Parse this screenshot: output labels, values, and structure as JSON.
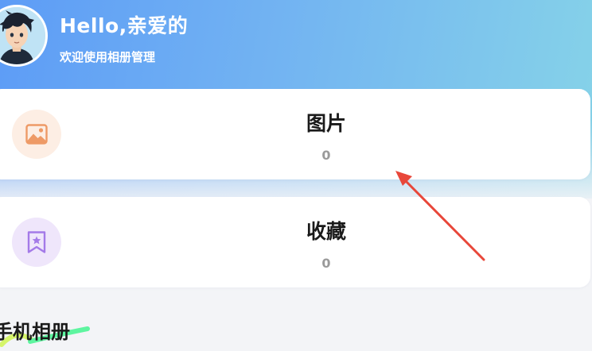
{
  "header": {
    "greeting": "Hello,亲爱的",
    "subtitle": "欢迎使用相册管理",
    "avatar_icon": "avatar-icon",
    "gradient_start": "#5d9cf6",
    "gradient_end": "#86d3e8"
  },
  "cards": [
    {
      "title": "图片",
      "count": "0",
      "icon": "image-icon",
      "icon_color": "#ee9a66",
      "icon_bg": "#fdeee4"
    },
    {
      "title": "收藏",
      "count": "0",
      "icon": "bookmark-star-icon",
      "icon_color": "#a47ae8",
      "icon_bg": "#efe6fb"
    }
  ],
  "section": {
    "title": "手机相册",
    "accent_color": "#5ef5a0"
  },
  "annotation": {
    "arrow_color": "#e8473a"
  }
}
